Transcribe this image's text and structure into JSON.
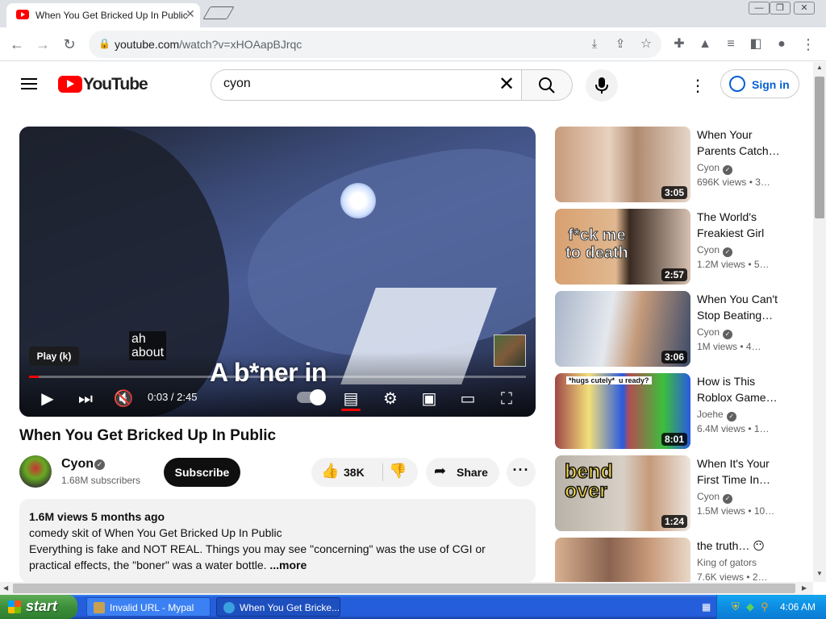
{
  "browser": {
    "tab_title": "When You Get Bricked Up In Public",
    "tab_close": "✕",
    "url_host": "youtube.com",
    "url_path": "/watch?v=xHOAapBJrqc",
    "window_controls": [
      "—",
      "❐",
      "✕"
    ]
  },
  "youtube": {
    "logo_text": "YouTube",
    "search_value": "cyon",
    "signin_label": "Sign in"
  },
  "player": {
    "tooltip": "Play (k)",
    "caption_small_line1": "ah",
    "caption_small_line2": "about",
    "caption_big": "A b*ner in",
    "time": "0:03 / 2:45",
    "progress_fraction": 0.019
  },
  "video": {
    "title": "When You Get Bricked Up In Public",
    "channel": "Cyon",
    "subscribers": "1.68M subscribers",
    "subscribe_label": "Subscribe",
    "likes": "38K",
    "share_label": "Share",
    "description_meta": "1.6M views  5 months ago",
    "description_line1": "comedy skit of When You Get Bricked Up In Public",
    "description_line2": "Everything is fake and NOT REAL. Things you may see \"concerning\" was the use of CGI  or practical effects, the \"boner\" was a water bottle.",
    "description_more": "...more"
  },
  "recommendations": [
    {
      "title": "When Your Parents Catch…",
      "channel": "Cyon",
      "verified": true,
      "meta": "696K views  • 3…",
      "duration": "3:05",
      "thumb_text": ""
    },
    {
      "title": "The World's Freakiest Girl",
      "channel": "Cyon",
      "verified": true,
      "meta": "1.2M views  • 5…",
      "duration": "2:57",
      "thumb_text": "f*ck me to death"
    },
    {
      "title": "When You Can't Stop Beating…",
      "channel": "Cyon",
      "verified": true,
      "meta": "1M views  • 4…",
      "duration": "3:06",
      "thumb_text": ""
    },
    {
      "title": "How is This Roblox Game…",
      "channel": "Joehe",
      "verified": true,
      "meta": "6.4M views  • 1…",
      "duration": "8:01",
      "thumb_text": "*hugs cutely*  u ready?"
    },
    {
      "title": "When It's Your First Time In…",
      "channel": "Cyon",
      "verified": true,
      "meta": "1.5M views  • 10…",
      "duration": "1:24",
      "thumb_text": "bend over"
    },
    {
      "title": "the truth… 😶",
      "channel": "King of gators",
      "verified": false,
      "meta": "7.6K views  • 2…",
      "duration": "",
      "thumb_text": ""
    }
  ],
  "taskbar": {
    "start_label": "start",
    "tasks": [
      "Invalid URL - Mypal",
      "When You Get Bricke..."
    ],
    "clock": "4:06 AM"
  },
  "colors": {
    "youtube_red": "#ff0000",
    "link_blue": "#065fd4",
    "xp_blue": "#245edb",
    "xp_green": "#3c8f3b"
  }
}
